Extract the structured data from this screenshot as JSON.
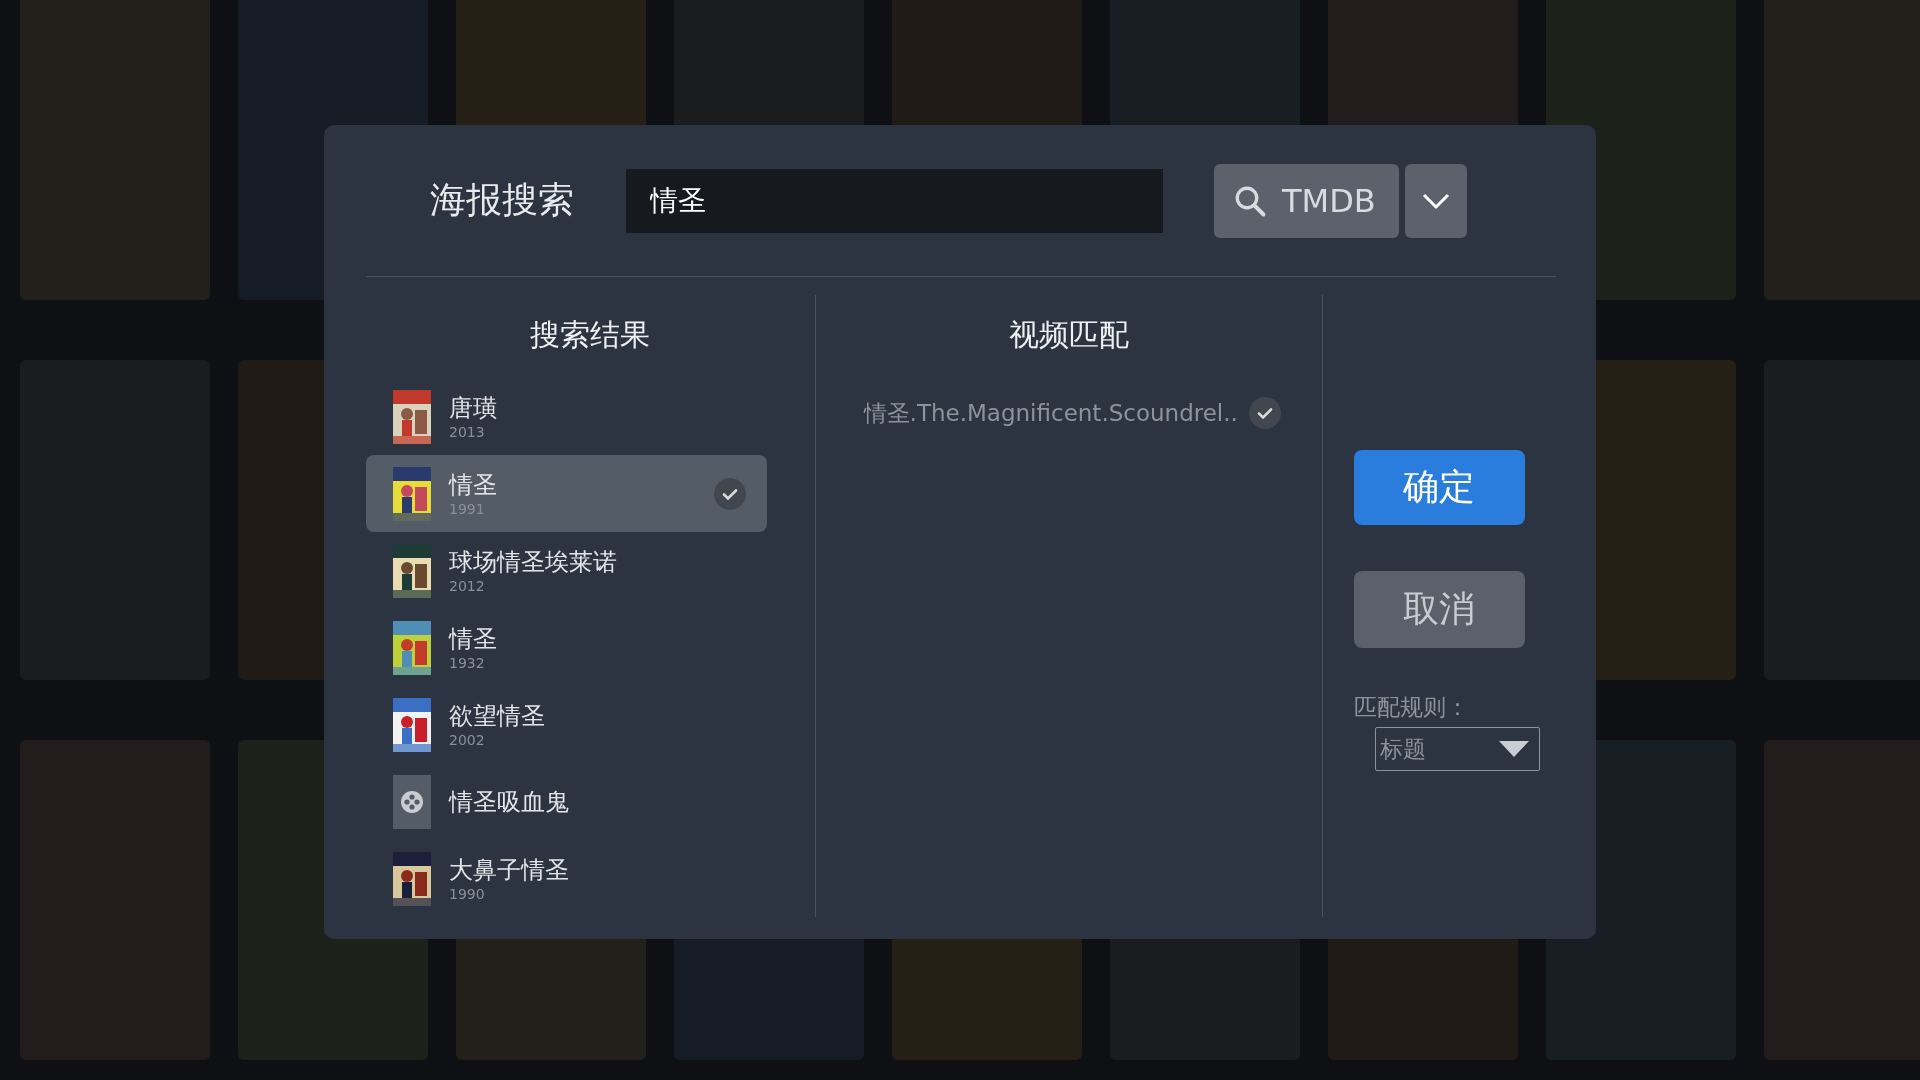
{
  "dialog": {
    "title": "海报搜索",
    "search": {
      "value": "情圣"
    },
    "search_button": {
      "label": "TMDB"
    }
  },
  "results": {
    "header": "搜索结果",
    "items": [
      {
        "title": "唐璜",
        "year": "2013",
        "selected": false,
        "kind": "poster"
      },
      {
        "title": "情圣",
        "year": "1991",
        "selected": true,
        "kind": "poster"
      },
      {
        "title": "球场情圣埃莱诺",
        "year": "2012",
        "selected": false,
        "kind": "poster"
      },
      {
        "title": "情圣",
        "year": "1932",
        "selected": false,
        "kind": "poster"
      },
      {
        "title": "欲望情圣",
        "year": "2002",
        "selected": false,
        "kind": "poster"
      },
      {
        "title": "情圣吸血鬼",
        "selected": false,
        "kind": "placeholder"
      },
      {
        "title": "大鼻子情圣",
        "year": "1990",
        "selected": false,
        "kind": "poster"
      }
    ]
  },
  "match": {
    "header": "视频匹配",
    "items": [
      {
        "text": "情圣.The.Magnificent.Scoundrel..",
        "checked": true
      }
    ]
  },
  "actions": {
    "confirm": "确定",
    "cancel": "取消",
    "rule_label": "匹配规则：",
    "rule_value": "标题"
  }
}
